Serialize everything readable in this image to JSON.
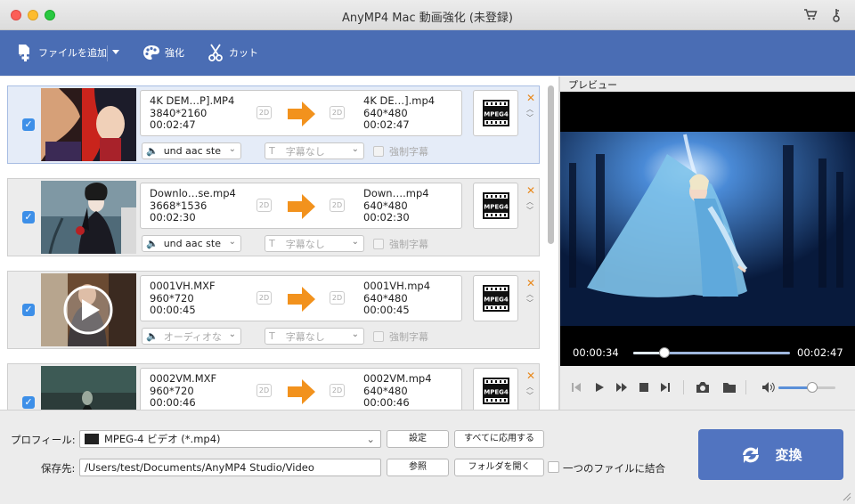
{
  "window": {
    "title": "AnyMP4 Mac 動画強化 (未登録)"
  },
  "toolbar": {
    "add_file": "ファイルを追加",
    "enhance": "強化",
    "cut": "カット"
  },
  "files": [
    {
      "src_name": "4K DEM…P].MP4",
      "src_res": "3840*2160",
      "src_dur": "00:02:47",
      "dst_name": "4K DE…].mp4",
      "dst_res": "640*480",
      "dst_dur": "00:02:47",
      "audio": "und aac ste",
      "subtitle": "字幕なし",
      "force_sub": "強制字幕",
      "badge_2d": "2D",
      "format_badge": "MPEG4"
    },
    {
      "src_name": "Downlo…se.mp4",
      "src_res": "3668*1536",
      "src_dur": "00:02:30",
      "dst_name": "Down….mp4",
      "dst_res": "640*480",
      "dst_dur": "00:02:30",
      "audio": "und aac ste",
      "subtitle": "字幕なし",
      "force_sub": "強制字幕",
      "badge_2d": "2D",
      "format_badge": "MPEG4"
    },
    {
      "src_name": "0001VH.MXF",
      "src_res": "960*720",
      "src_dur": "00:00:45",
      "dst_name": "0001VH.mp4",
      "dst_res": "640*480",
      "dst_dur": "00:00:45",
      "audio": "オーディオな",
      "subtitle": "字幕なし",
      "force_sub": "強制字幕",
      "badge_2d": "2D",
      "format_badge": "MPEG4"
    },
    {
      "src_name": "0002VM.MXF",
      "src_res": "960*720",
      "src_dur": "00:00:46",
      "dst_name": "0002VM.mp4",
      "dst_res": "640*480",
      "dst_dur": "00:00:46",
      "badge_2d": "2D",
      "format_badge": "MPEG4"
    }
  ],
  "preview": {
    "label": "プレビュー",
    "current_time": "00:00:34",
    "total_time": "00:02:47",
    "progress": 0.2,
    "volume": 0.6
  },
  "bottom": {
    "profile_label": "プロフィール:",
    "profile_value": "MPEG-4 ビデオ (*.mp4)",
    "settings_button": "設定",
    "apply_all_button": "すべてに応用する",
    "save_label": "保存先:",
    "save_path": "/Users/test/Documents/AnyMP4 Studio/Video",
    "browse_button": "参照",
    "open_folder_button": "フォルダを開く",
    "merge_label": "一つのファイルに結合",
    "convert_button": "変換"
  },
  "colors": {
    "accent": "#4a6db4",
    "arrow": "#f2921d",
    "close_x": "#e8891d",
    "check": "#3d8fe8"
  }
}
